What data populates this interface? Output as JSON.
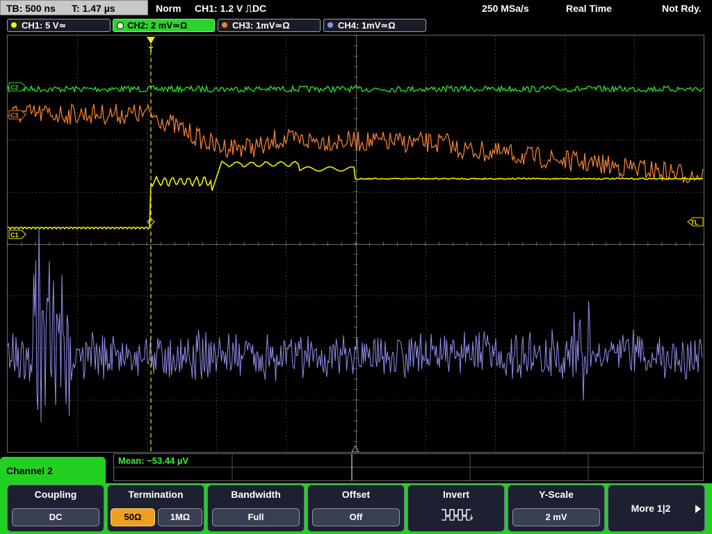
{
  "status_bar": {
    "timebase": "TB: 500 ns",
    "trigger_time": "T: 1.47 µs",
    "mode": "Norm",
    "trigger_setting": "CH1: 1.2 V ⎍DC",
    "sample_rate": "250 MSa/s",
    "acquisition": "Real Time",
    "state": "Not Rdy."
  },
  "channels": [
    {
      "label": "CH1: 5 V≃",
      "color": "#f2f200",
      "active": false
    },
    {
      "label": "CH2: 2 mV≃Ω",
      "color": "#2ee02e",
      "active": true
    },
    {
      "label": "CH3: 1mV≃Ω",
      "color": "#f08030",
      "active": false
    },
    {
      "label": "CH4: 1mV≃Ω",
      "color": "#9090ee",
      "active": false
    }
  ],
  "markers": {
    "trigger_marker": "T",
    "trigger_level": "TL",
    "ch1_ref": "C1",
    "ch2_ref": "C2",
    "ch3_ref": "C3"
  },
  "measurement": {
    "mean": "Mean: −53.44 µV"
  },
  "menu_title": "Channel 2",
  "softkeys": {
    "coupling": {
      "title": "Coupling",
      "value": "DC"
    },
    "termination": {
      "title": "Termination",
      "option_a": "50Ω",
      "option_b": "1MΩ"
    },
    "bandwidth": {
      "title": "Bandwidth",
      "value": "Full"
    },
    "offset": {
      "title": "Offset",
      "value": "Off"
    },
    "invert": {
      "title": "Invert",
      "icon": "invert-waveform-icon"
    },
    "yscale": {
      "title": "Y-Scale",
      "value": "2 mV"
    },
    "more": {
      "label": "More 1|2"
    }
  }
}
